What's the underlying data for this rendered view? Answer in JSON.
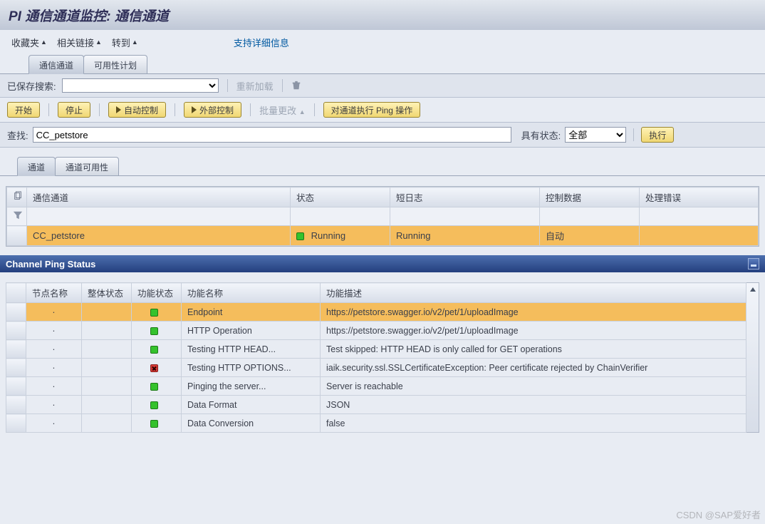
{
  "header": {
    "title": "PI 通信通道监控: 通信通道"
  },
  "nav": {
    "favorites": "收藏夹",
    "related": "相关链接",
    "goto": "转到",
    "support": "支持详细信息"
  },
  "top_tabs": {
    "channels": "通信通道",
    "availability_plan": "可用性计划"
  },
  "saved_search": {
    "label": "已保存搜索:",
    "value": "",
    "reload": "重新加载"
  },
  "actions": {
    "start": "开始",
    "stop": "停止",
    "auto_control": "自动控制",
    "ext_control": "外部控制",
    "batch_modify": "批量更改",
    "ping": "对通道执行 Ping 操作"
  },
  "find": {
    "label": "查找:",
    "value": "CC_petstore",
    "with_status_label": "具有状态:",
    "with_status_value": "全部",
    "execute": "执行"
  },
  "sub_tabs": {
    "channel": "通道",
    "channel_avail": "通道可用性"
  },
  "channel_table": {
    "headers": {
      "channel": "通信通道",
      "status": "状态",
      "short_log": "短日志",
      "control": "控制数据",
      "errors": "处理错误"
    },
    "rows": [
      {
        "channel": "CC_petstore",
        "status_text": "Running",
        "log": "Running",
        "control": "自动",
        "errors": ""
      }
    ]
  },
  "ping_panel": {
    "title": "Channel Ping Status",
    "headers": {
      "node": "节点名称",
      "overall": "整体状态",
      "func_status": "功能状态",
      "func_name": "功能名称",
      "func_desc": "功能描述"
    },
    "rows": [
      {
        "node": "·",
        "func_ok": true,
        "name": "Endpoint",
        "desc": "https://petstore.swagger.io/v2/pet/1/uploadImage"
      },
      {
        "node": "·",
        "func_ok": true,
        "name": "HTTP Operation",
        "desc": "https://petstore.swagger.io/v2/pet/1/uploadImage"
      },
      {
        "node": "·",
        "func_ok": true,
        "name": "Testing HTTP HEAD...",
        "desc": "Test skipped: HTTP HEAD is only called for GET operations"
      },
      {
        "node": "·",
        "func_ok": false,
        "name": "Testing HTTP OPTIONS...",
        "desc": "iaik.security.ssl.SSLCertificateException: Peer certificate rejected by ChainVerifier"
      },
      {
        "node": "·",
        "func_ok": true,
        "name": "Pinging the server...",
        "desc": "Server is reachable"
      },
      {
        "node": "·",
        "func_ok": true,
        "name": "Data Format",
        "desc": "JSON"
      },
      {
        "node": "·",
        "func_ok": true,
        "name": "Data Conversion",
        "desc": "false"
      }
    ]
  },
  "watermark": "CSDN @SAP爱好者"
}
